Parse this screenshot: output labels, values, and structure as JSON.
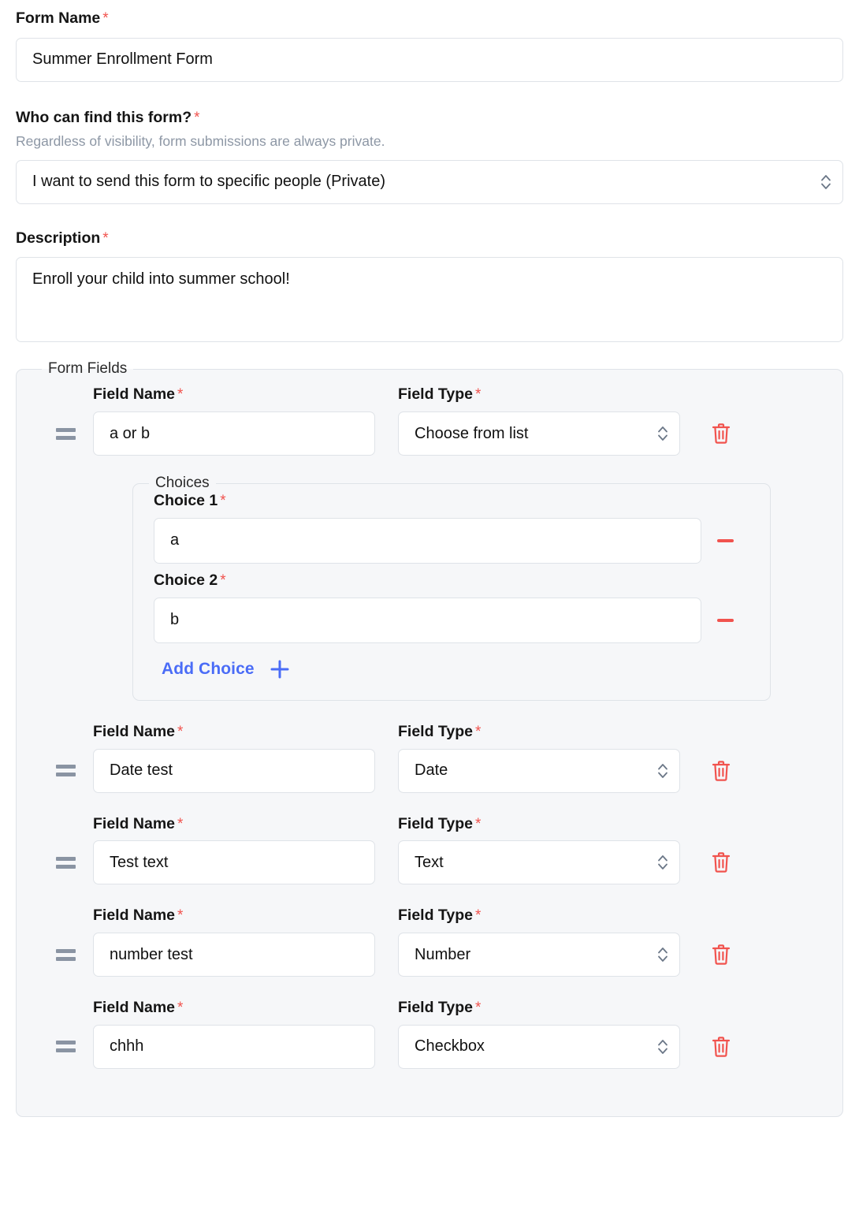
{
  "colors": {
    "required_asterisk": "#f1534e",
    "delete_icon": "#f1534e",
    "accent_link": "#4a6cf7",
    "panel_background": "#f6f7f9",
    "input_border": "#dfe3e8",
    "muted_text": "#8d97a5",
    "drag_handle": "#8a94a3"
  },
  "form_name": {
    "label": "Form Name",
    "required_marker": "*",
    "value": "Summer Enrollment Form"
  },
  "visibility": {
    "label": "Who can find this form?",
    "required_marker": "*",
    "help_text": "Regardless of visibility, form submissions are always private.",
    "selected": "I want to send this form to specific people (Private)"
  },
  "description": {
    "label": "Description",
    "required_marker": "*",
    "value": "Enroll your child into summer school!"
  },
  "form_fields": {
    "legend": "Form Fields",
    "field_name_label": "Field Name",
    "field_type_label": "Field Type",
    "required_marker": "*",
    "drag_handle_icon": "drag-handle-icon",
    "delete_icon": "trash-icon",
    "select_icon": "chevron-up-down-icon",
    "rows": [
      {
        "name": "a or b",
        "type": "Choose from list"
      },
      {
        "name": "Date test",
        "type": "Date"
      },
      {
        "name": "Test text",
        "type": "Text"
      },
      {
        "name": "number test",
        "type": "Number"
      },
      {
        "name": "chhh",
        "type": "Checkbox"
      }
    ]
  },
  "choices": {
    "legend": "Choices",
    "required_marker": "*",
    "items": [
      {
        "label": "Choice 1",
        "value": "a"
      },
      {
        "label": "Choice 2",
        "value": "b"
      }
    ],
    "add_label": "Add Choice",
    "add_icon": "plus-icon",
    "remove_icon": "minus-icon"
  }
}
